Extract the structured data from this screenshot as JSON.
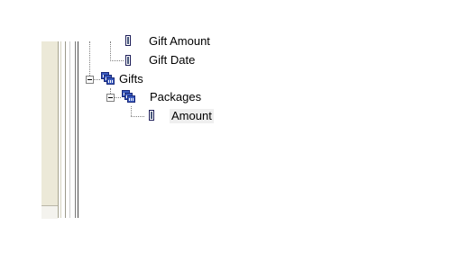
{
  "tree": {
    "items": [
      {
        "label": "Gift Amount",
        "type": "field"
      },
      {
        "label": "Gift Date",
        "type": "field"
      },
      {
        "label": "Gifts",
        "type": "table",
        "expanded": true
      },
      {
        "label": "Packages",
        "type": "table",
        "expanded": true
      },
      {
        "label": "Amount",
        "type": "field",
        "selected": true
      }
    ]
  },
  "icons": {
    "field": "field-icon",
    "table": "table-icon",
    "expander": "collapse-icon"
  }
}
